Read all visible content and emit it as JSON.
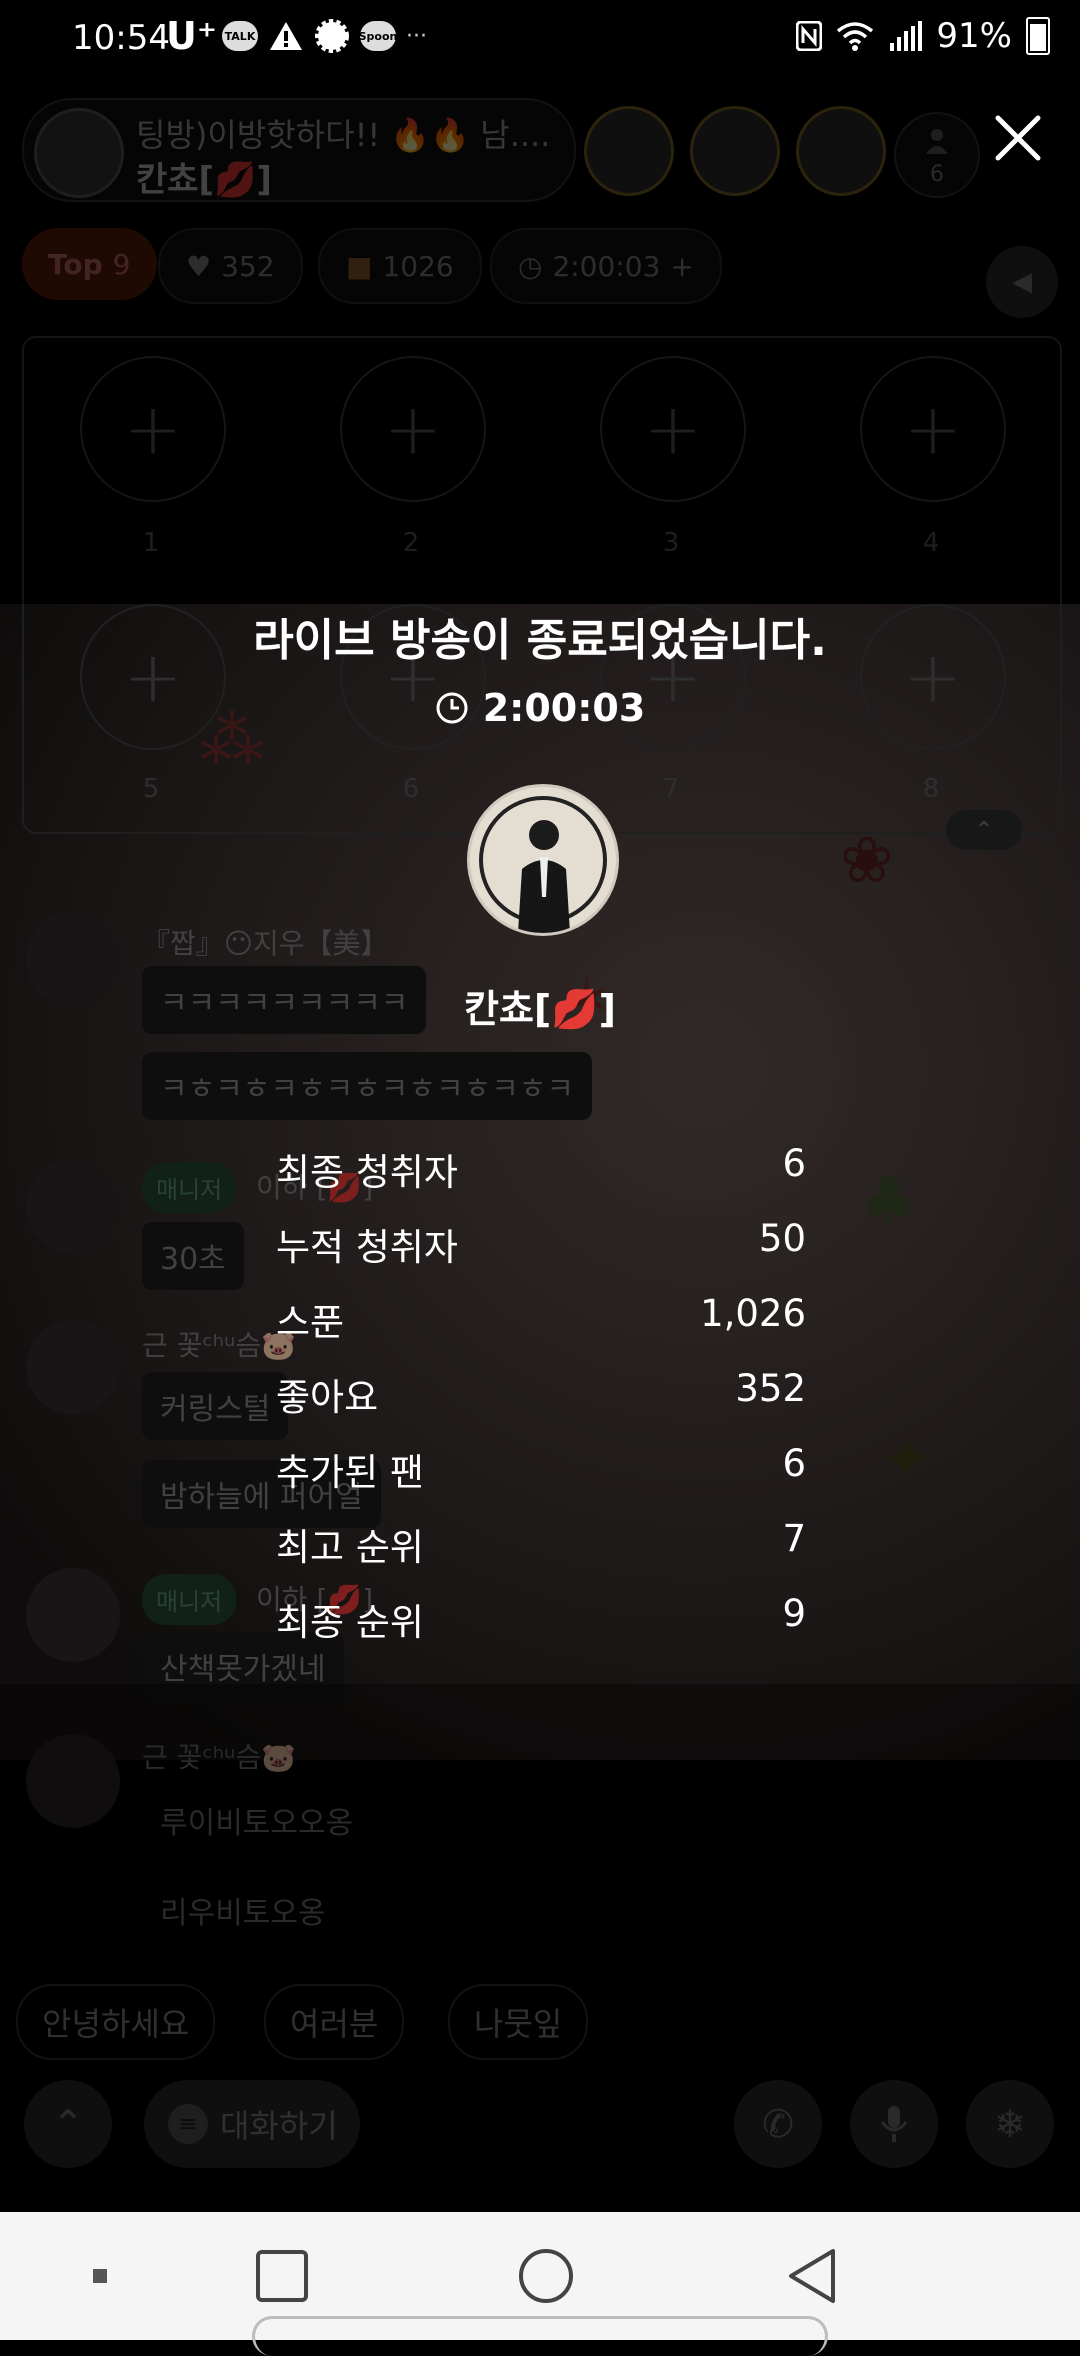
{
  "status_bar": {
    "time": "10:54",
    "carrier": "U⁺",
    "app_chips": [
      "TALK",
      "Spoon"
    ],
    "overflow": "···",
    "battery": "91%"
  },
  "room": {
    "title": "팅방)이방핫하다!! 🔥🔥 남....",
    "host_name": "칸쵸[💋]",
    "listener_count": "6",
    "top_label": "Top",
    "top_rank": "9",
    "likes": "352",
    "gifts": "1026",
    "elapsed": "2:00:03",
    "seats": [
      "1",
      "2",
      "3",
      "4",
      "5",
      "6",
      "7",
      "8"
    ]
  },
  "chat": [
    {
      "name": "『짭』😶지우【美】",
      "messages": [
        "ㅋㅋㅋㅋㅋㅋㅋㅋㅋ",
        "ㅋㅎㅋㅎㅋㅎㅋㅎㅋㅎㅋㅎㅋㅎㅋ"
      ]
    },
    {
      "badge": "매니저",
      "name": "이하 [💋]",
      "messages": [
        "30초"
      ]
    },
    {
      "name": "근 꽃ᶜʰᵘ슴🐷",
      "messages": [
        "커링스털",
        "밤하늘에 퍼어얼"
      ]
    },
    {
      "badge": "매니저",
      "name": "이하 [💋]",
      "messages": [
        "산책못가겠네"
      ]
    },
    {
      "name": "근 꽃ᶜʰᵘ슴🐷",
      "messages": [
        "루이비토오오옹",
        "리우비토오옹"
      ]
    }
  ],
  "quick_replies": [
    "안녕하세요",
    "여러분",
    "나뭇잎"
  ],
  "chat_input_placeholder": "대화하기",
  "ended": {
    "title": "라이브 방송이 종료되었습니다.",
    "duration": "2:00:03",
    "host_name": "칸쵸[💋]",
    "stats": [
      {
        "label": "최종 청취자",
        "value": "6"
      },
      {
        "label": "누적 청취자",
        "value": "50"
      },
      {
        "label": "스푼",
        "value": "1,026"
      },
      {
        "label": "좋아요",
        "value": "352"
      },
      {
        "label": "추가된 팬",
        "value": "6"
      },
      {
        "label": "최고 순위",
        "value": "7"
      },
      {
        "label": "최종 순위",
        "value": "9"
      }
    ]
  },
  "colors": {
    "accent": "#ff5a1f",
    "manager_badge": "#2f6b46",
    "nav_bar": "#f5f5f5"
  }
}
